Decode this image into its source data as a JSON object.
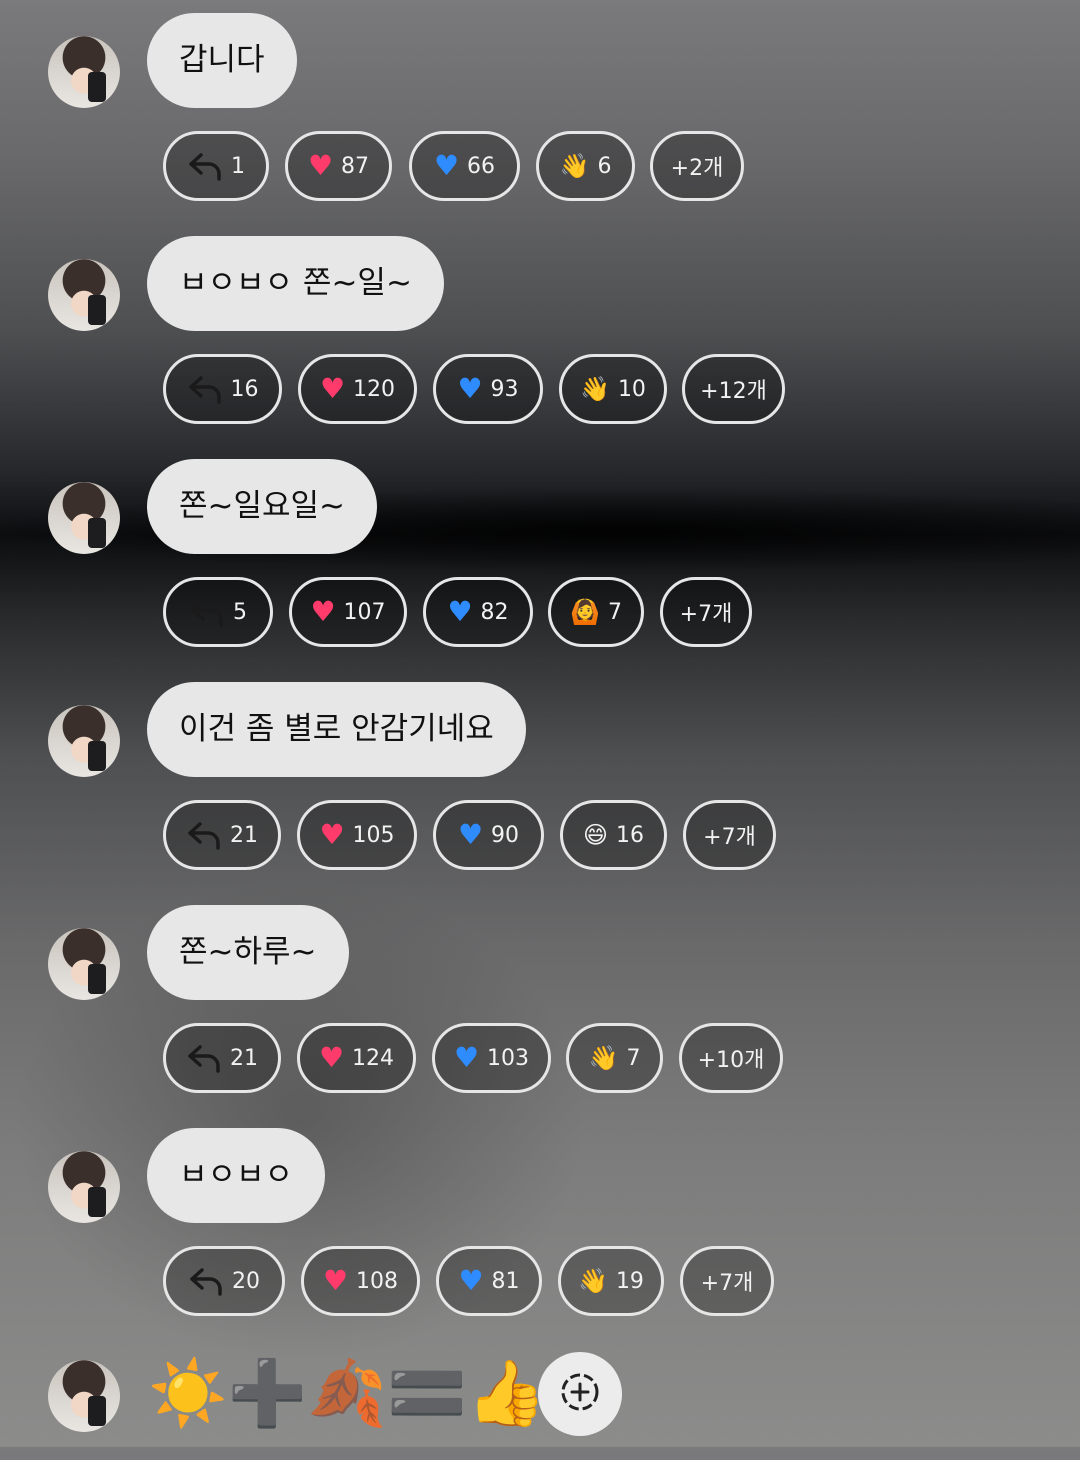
{
  "messages": [
    {
      "text": "갑니다",
      "reactions": [
        {
          "type": "reply",
          "icon": "reply-arrow-icon",
          "count": "1"
        },
        {
          "type": "heart",
          "icon": "red-heart-icon",
          "glyph": "♥",
          "count": "87"
        },
        {
          "type": "heart",
          "icon": "blue-heart-icon",
          "glyph": "♥",
          "count": "66"
        },
        {
          "type": "emoji",
          "icon": "waving-hand-icon",
          "glyph": "👋",
          "count": "6"
        }
      ],
      "more": "+2개"
    },
    {
      "text": "ㅂㅇㅂㅇ 쫀~일~",
      "reactions": [
        {
          "type": "reply",
          "icon": "reply-arrow-icon",
          "count": "16"
        },
        {
          "type": "heart",
          "icon": "red-heart-icon",
          "glyph": "♥",
          "count": "120"
        },
        {
          "type": "heart",
          "icon": "blue-heart-icon",
          "glyph": "♥",
          "count": "93"
        },
        {
          "type": "emoji",
          "icon": "waving-hand-icon",
          "glyph": "👋",
          "count": "10"
        }
      ],
      "more": "+12개"
    },
    {
      "text": "쫀~일요일~",
      "reactions": [
        {
          "type": "reply",
          "icon": "reply-arrow-icon",
          "count": "5"
        },
        {
          "type": "heart",
          "icon": "red-heart-icon",
          "glyph": "♥",
          "count": "107"
        },
        {
          "type": "heart",
          "icon": "blue-heart-icon",
          "glyph": "♥",
          "count": "82"
        },
        {
          "type": "emoji",
          "icon": "person-heart-hands-icon",
          "glyph": "🙆",
          "count": "7"
        }
      ],
      "more": "+7개"
    },
    {
      "text": "이건 좀 별로 안감기네요",
      "reactions": [
        {
          "type": "reply",
          "icon": "reply-arrow-icon",
          "count": "21"
        },
        {
          "type": "heart",
          "icon": "red-heart-icon",
          "glyph": "♥",
          "count": "105"
        },
        {
          "type": "heart",
          "icon": "blue-heart-icon",
          "glyph": "♥",
          "count": "90"
        },
        {
          "type": "emoji",
          "icon": "grinning-face-icon",
          "glyph": "😄",
          "count": "16"
        }
      ],
      "more": "+7개"
    },
    {
      "text": "쫀~하루~",
      "reactions": [
        {
          "type": "reply",
          "icon": "reply-arrow-icon",
          "count": "21"
        },
        {
          "type": "heart",
          "icon": "red-heart-icon",
          "glyph": "♥",
          "count": "124"
        },
        {
          "type": "heart",
          "icon": "blue-heart-icon",
          "glyph": "♥",
          "count": "103"
        },
        {
          "type": "emoji",
          "icon": "waving-hand-icon",
          "glyph": "👋",
          "count": "7"
        }
      ],
      "more": "+10개"
    },
    {
      "text": "ㅂㅇㅂㅇ",
      "reactions": [
        {
          "type": "reply",
          "icon": "reply-arrow-icon",
          "count": "20"
        },
        {
          "type": "heart",
          "icon": "red-heart-icon",
          "glyph": "♥",
          "count": "108"
        },
        {
          "type": "heart",
          "icon": "blue-heart-icon",
          "glyph": "♥",
          "count": "81"
        },
        {
          "type": "emoji",
          "icon": "waving-hand-icon",
          "glyph": "👋",
          "count": "19"
        }
      ],
      "more": "+7개"
    }
  ],
  "last_message": {
    "emojis": "☀️➕🍂🟰👍",
    "add_reaction_icon": "add-reaction-icon"
  },
  "colors": {
    "bubble_bg": "#e7e7e7",
    "chip_border": "#e6e6e6",
    "red_heart": "#ff3b6b",
    "blue_heart": "#2f8cff"
  }
}
